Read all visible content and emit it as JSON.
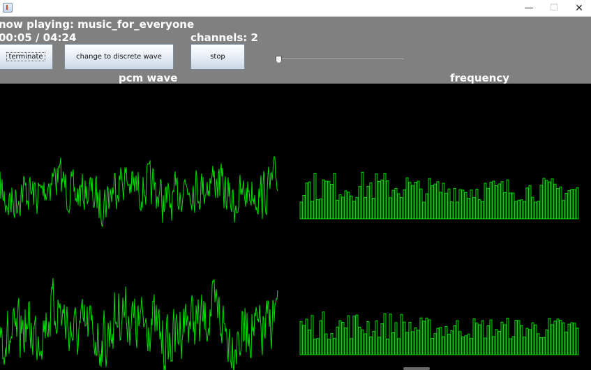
{
  "window": {
    "title": ""
  },
  "info": {
    "now_playing": "now playing: music_for_everyone",
    "time": "00:05 / 04:24",
    "channels": "channels: 2"
  },
  "buttons": {
    "terminate": "terminate",
    "change_wave": "change to discrete wave",
    "stop": "stop"
  },
  "slider": {
    "value": 0.02
  },
  "labels": {
    "pcm": "pcm wave",
    "frequency": "frequency"
  },
  "colors": {
    "wave": "#00e000",
    "panel": "#808080",
    "canvas": "#000000"
  },
  "icons": {
    "app": "java-app-icon",
    "minimize": "minimize-icon",
    "maximize": "maximize-icon",
    "close": "close-icon"
  }
}
